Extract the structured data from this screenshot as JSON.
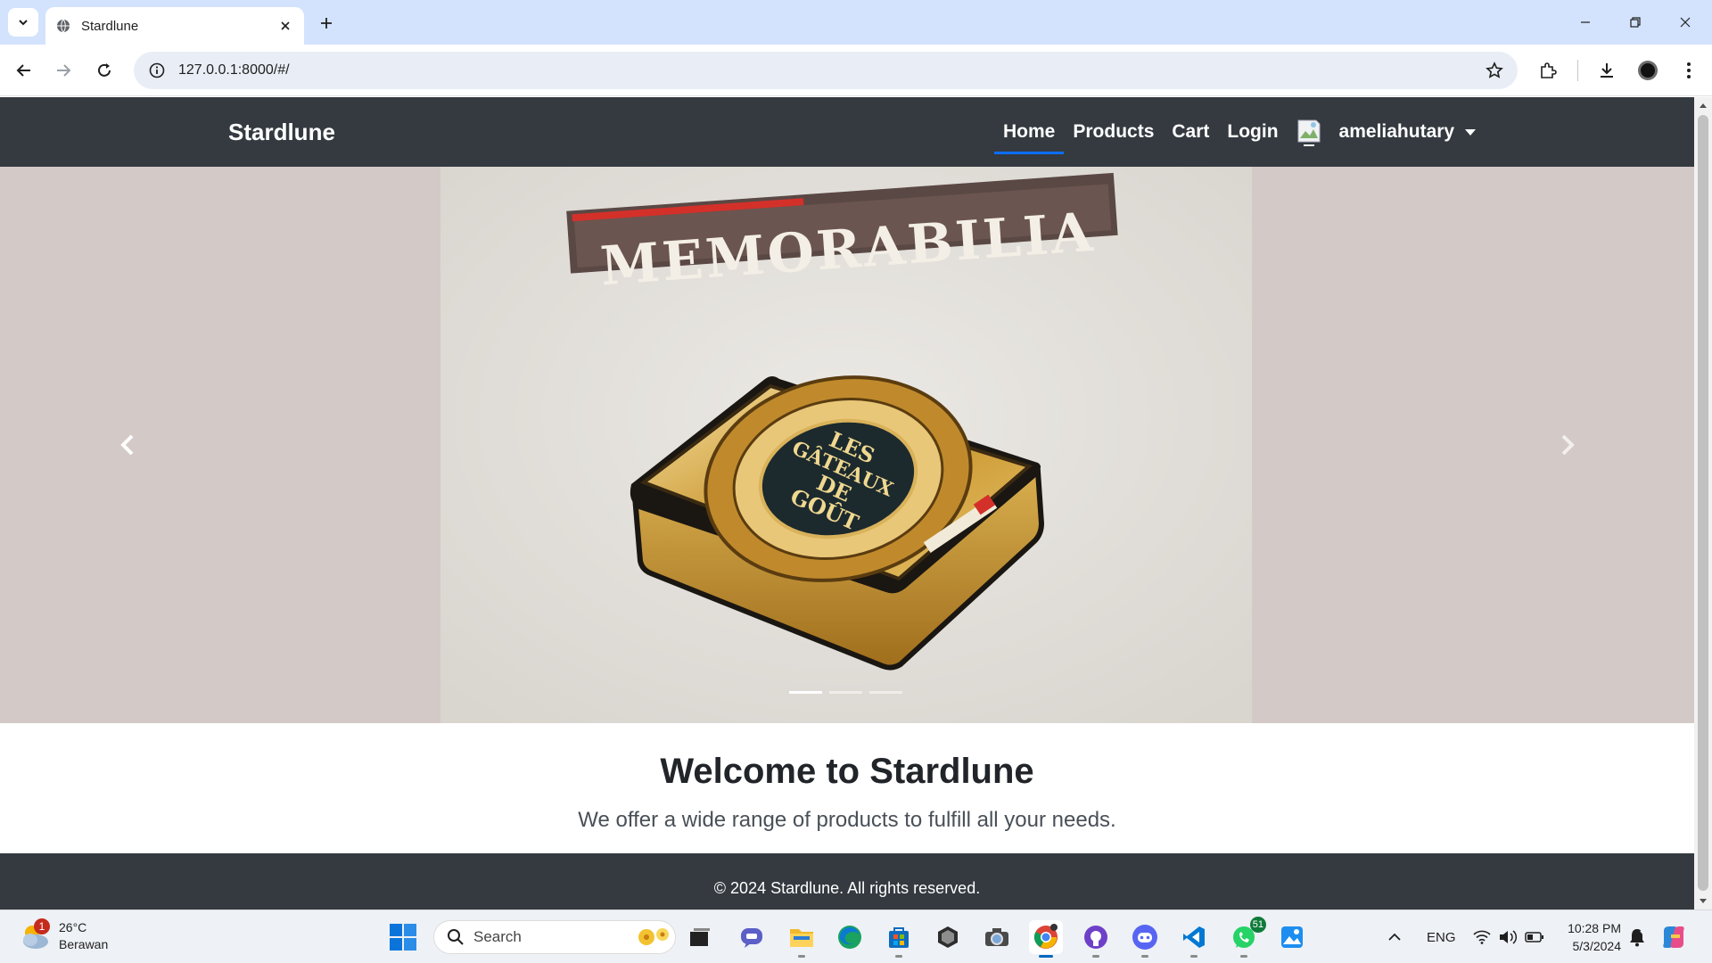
{
  "browser": {
    "tab_title": "Stardlune",
    "url": "127.0.0.1:8000/#/"
  },
  "site": {
    "brand": "Stardlune",
    "nav": {
      "home": "Home",
      "products": "Products",
      "cart": "Cart",
      "login": "Login",
      "username": "ameliahutary"
    },
    "carousel": {
      "slide_text": "MEMORABILIA",
      "tin_lines": [
        "LES",
        "GÂTEAUX",
        "DE",
        "GOÛT"
      ],
      "slide_count": 3,
      "active_slide": 1
    },
    "welcome": {
      "title": "Welcome to Stardlune",
      "subtitle": "We offer a wide range of products to fulfill all your needs."
    },
    "footer": "© 2024 Stardlune. All rights reserved."
  },
  "taskbar": {
    "weather_temp": "26°C",
    "weather_desc": "Berawan",
    "weather_badge": "1",
    "search_label": "Search",
    "whatsapp_badge": "51",
    "language": "ENG",
    "time": "10:28 PM",
    "date": "5/3/2024"
  },
  "colors": {
    "navbar": "#343a40",
    "carousel_bg": "#d3c9c6",
    "tabbar": "#d3e3fd",
    "active_underline": "#0d6efd"
  }
}
